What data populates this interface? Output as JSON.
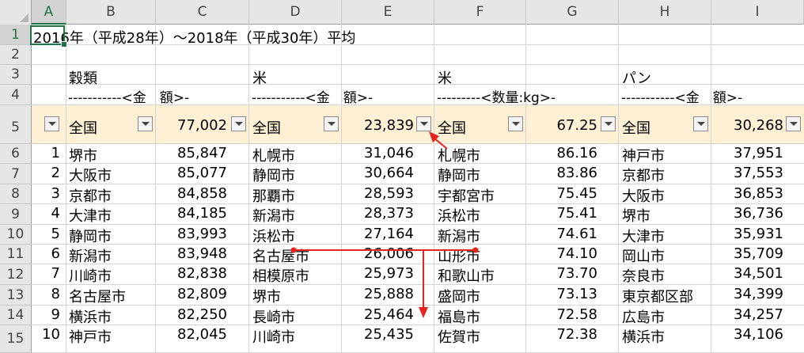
{
  "columns": [
    "A",
    "B",
    "C",
    "D",
    "E",
    "F",
    "G",
    "H",
    "I"
  ],
  "rows": [
    "1",
    "2",
    "3",
    "4",
    "5",
    "6",
    "7",
    "8",
    "9",
    "10",
    "11",
    "12",
    "13",
    "14",
    "15"
  ],
  "active_cell": "A1",
  "title": "2016年（平成28年）～2018年（平成30年）平均",
  "headers": {
    "cat_b": "穀類",
    "cat_d": "米",
    "cat_f": "米",
    "cat_h": "パン",
    "sub_b": "-----------<金　額>-",
    "sub_d": "-----------<金　額>-",
    "sub_f": "---------<数量:kg>-",
    "sub_h": "-----------<金　額>-"
  },
  "national": {
    "label_b": "全国",
    "value_c": "77,002",
    "label_d": "全国",
    "value_e": "23,839",
    "label_f": "全国",
    "value_g": "67.25",
    "label_h": "全国",
    "value_i": "30,268"
  },
  "table_rows": [
    {
      "rank": "1",
      "b": "堺市",
      "c": "85,847",
      "d": "札幌市",
      "e": "31,046",
      "f": "札幌市",
      "g": "86.16",
      "h": "神戸市",
      "i": "37,951"
    },
    {
      "rank": "2",
      "b": "大阪市",
      "c": "85,077",
      "d": "静岡市",
      "e": "30,664",
      "f": "静岡市",
      "g": "83.86",
      "h": "京都市",
      "i": "37,553"
    },
    {
      "rank": "3",
      "b": "京都市",
      "c": "84,858",
      "d": "那覇市",
      "e": "28,593",
      "f": "宇都宮市",
      "g": "75.45",
      "h": "大阪市",
      "i": "36,853"
    },
    {
      "rank": "4",
      "b": "大津市",
      "c": "84,185",
      "d": "新潟市",
      "e": "28,373",
      "f": "浜松市",
      "g": "75.41",
      "h": "堺市",
      "i": "36,736"
    },
    {
      "rank": "5",
      "b": "静岡市",
      "c": "83,993",
      "d": "浜松市",
      "e": "27,164",
      "f": "新潟市",
      "g": "74.61",
      "h": "大津市",
      "i": "35,931"
    },
    {
      "rank": "6",
      "b": "新潟市",
      "c": "83,948",
      "d": "名古屋市",
      "e": "26,006",
      "f": "山形市",
      "g": "74.10",
      "h": "岡山市",
      "i": "35,709"
    },
    {
      "rank": "7",
      "b": "川崎市",
      "c": "82,838",
      "d": "相模原市",
      "e": "25,973",
      "f": "和歌山市",
      "g": "73.70",
      "h": "奈良市",
      "i": "34,501"
    },
    {
      "rank": "8",
      "b": "名古屋市",
      "c": "82,809",
      "d": "堺市",
      "e": "25,888",
      "f": "盛岡市",
      "g": "73.13",
      "h": "東京都区部",
      "i": "34,399"
    },
    {
      "rank": "9",
      "b": "横浜市",
      "c": "82,250",
      "d": "長崎市",
      "e": "25,464",
      "f": "福島市",
      "g": "72.58",
      "h": "広島市",
      "i": "34,257"
    },
    {
      "rank": "10",
      "b": "神戸市",
      "c": "82,045",
      "d": "川崎市",
      "e": "25,435",
      "f": "佐賀市",
      "g": "72.38",
      "h": "横浜市",
      "i": "34,106"
    }
  ],
  "annotation_color": "#e8231f",
  "accent_color": "#217346"
}
